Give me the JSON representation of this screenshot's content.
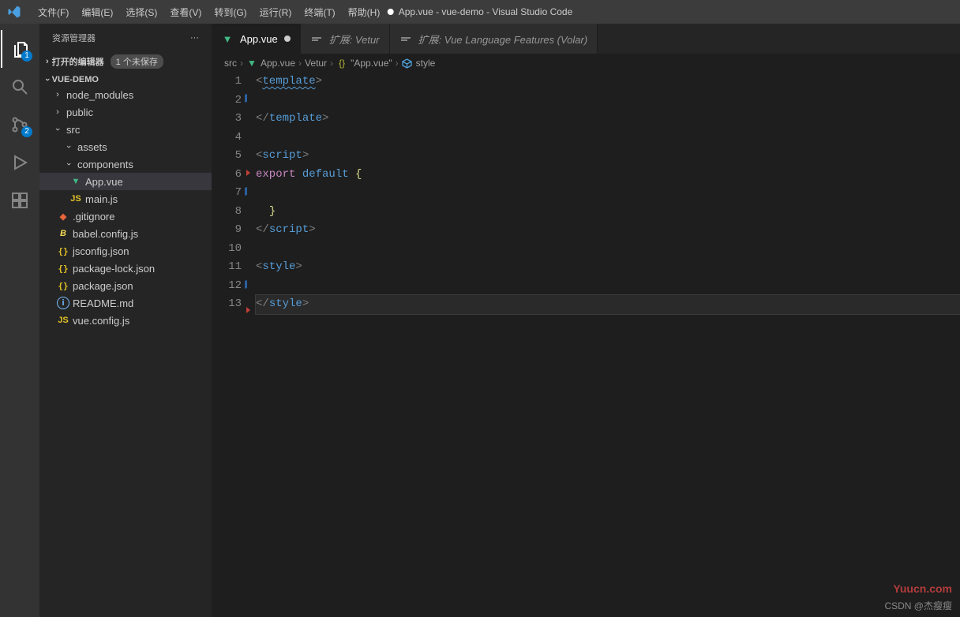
{
  "window": {
    "title": "App.vue - vue-demo - Visual Studio Code",
    "modified_dot": true
  },
  "menu": [
    "文件(F)",
    "编辑(E)",
    "选择(S)",
    "查看(V)",
    "转到(G)",
    "运行(R)",
    "终端(T)",
    "帮助(H)"
  ],
  "activitybar": {
    "explorer_badge": "1",
    "scm_badge": "2"
  },
  "sidebar": {
    "title": "资源管理器",
    "ellipsis": "···",
    "open_editors_label": "打开的编辑器",
    "open_editors_unsaved": "1 个未保存",
    "project_name": "VUE-DEMO",
    "tree": {
      "node_modules": "node_modules",
      "public": "public",
      "src": "src",
      "assets": "assets",
      "components": "components",
      "app_vue": "App.vue",
      "main_js": "main.js",
      "gitignore": ".gitignore",
      "babel": "babel.config.js",
      "jsconfig": "jsconfig.json",
      "pkglock": "package-lock.json",
      "pkg": "package.json",
      "readme": "README.md",
      "vueconfig": "vue.config.js"
    }
  },
  "tabs": [
    {
      "label": "App.vue",
      "active": true,
      "modified": true,
      "icon": "vue"
    },
    {
      "label": "扩展: Vetur",
      "active": false,
      "icon": "ext"
    },
    {
      "label": "扩展: Vue Language Features (Volar)",
      "active": false,
      "icon": "ext"
    }
  ],
  "breadcrumbs": {
    "items": [
      "src",
      "App.vue",
      "Vetur",
      "\"App.vue\"",
      "style"
    ]
  },
  "code": {
    "lines": [
      {
        "n": 1,
        "seg": [
          [
            "<",
            "brkt"
          ],
          [
            "template",
            "tag wavy"
          ],
          [
            ">",
            "brkt"
          ]
        ]
      },
      {
        "n": 2,
        "seg": []
      },
      {
        "n": 3,
        "seg": [
          [
            "</",
            "brkt"
          ],
          [
            "template",
            "tag"
          ],
          [
            ">",
            "brkt"
          ]
        ]
      },
      {
        "n": 4,
        "seg": []
      },
      {
        "n": 5,
        "seg": [
          [
            "<",
            "brkt"
          ],
          [
            "script",
            "tag"
          ],
          [
            ">",
            "brkt"
          ]
        ]
      },
      {
        "n": 6,
        "seg": [
          [
            "export",
            "kw"
          ],
          [
            " ",
            "plain"
          ],
          [
            "default",
            "kw2"
          ],
          [
            " ",
            "plain"
          ],
          [
            "{",
            "punc"
          ]
        ]
      },
      {
        "n": 7,
        "seg": []
      },
      {
        "n": 8,
        "seg": [
          [
            "  ",
            "plain"
          ],
          [
            "}",
            "punc"
          ]
        ]
      },
      {
        "n": 9,
        "seg": [
          [
            "</",
            "brkt"
          ],
          [
            "script",
            "tag"
          ],
          [
            ">",
            "brkt"
          ]
        ]
      },
      {
        "n": 10,
        "seg": []
      },
      {
        "n": 11,
        "seg": [
          [
            "<",
            "brkt"
          ],
          [
            "style",
            "tag"
          ],
          [
            ">",
            "brkt"
          ]
        ]
      },
      {
        "n": 12,
        "seg": []
      },
      {
        "n": 13,
        "seg": [
          [
            "</",
            "brkt"
          ],
          [
            "style",
            "tag"
          ],
          [
            ">",
            "brkt"
          ]
        ],
        "current": true
      }
    ]
  },
  "footer": {
    "csdn": "CSDN @杰瘦瘦",
    "yuucn": "Yuucn.com"
  }
}
